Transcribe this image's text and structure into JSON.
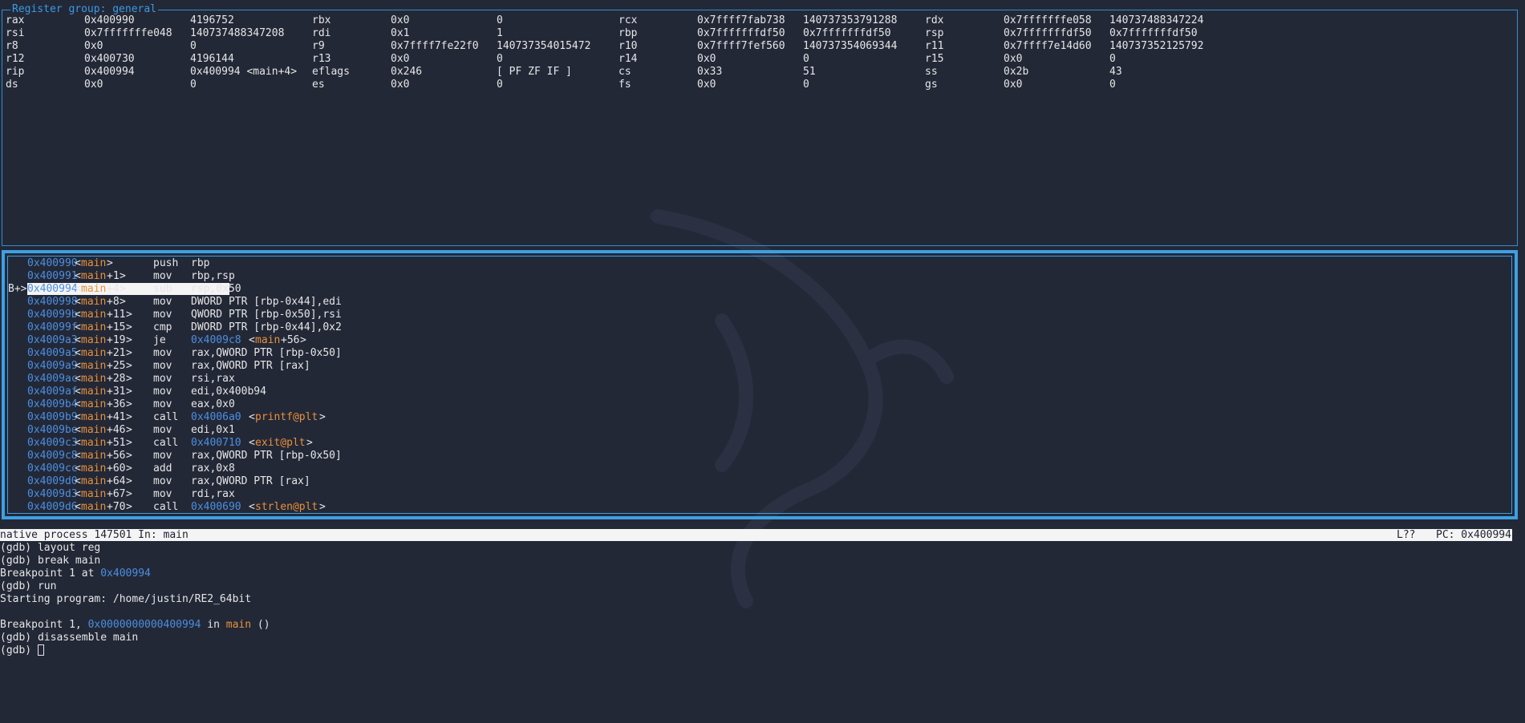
{
  "register_panel": {
    "title": "Register group: general",
    "rows": [
      [
        [
          "rax",
          "0x400990",
          "4196752"
        ],
        [
          "rbx",
          "0x0",
          "0"
        ],
        [
          "rcx",
          "0x7ffff7fab738",
          "140737353791288"
        ],
        [
          "rdx",
          "0x7fffffffe058",
          "140737488347224"
        ]
      ],
      [
        [
          "rsi",
          "0x7fffffffe048",
          "140737488347208"
        ],
        [
          "rdi",
          "0x1",
          "1"
        ],
        [
          "rbp",
          "0x7fffffffdf50",
          "0x7fffffffdf50"
        ],
        [
          "rsp",
          "0x7fffffffdf50",
          "0x7fffffffdf50"
        ]
      ],
      [
        [
          "r8",
          "0x0",
          "0"
        ],
        [
          "r9",
          "0x7ffff7fe22f0",
          "140737354015472"
        ],
        [
          "r10",
          "0x7ffff7fef560",
          "140737354069344"
        ],
        [
          "r11",
          "0x7ffff7e14d60",
          "140737352125792"
        ]
      ],
      [
        [
          "r12",
          "0x400730",
          "4196144"
        ],
        [
          "r13",
          "0x0",
          "0"
        ],
        [
          "r14",
          "0x0",
          "0"
        ],
        [
          "r15",
          "0x0",
          "0"
        ]
      ],
      [
        [
          "rip",
          "0x400994",
          "0x400994 <main+4>"
        ],
        [
          "eflags",
          "0x246",
          "[ PF ZF IF ]"
        ],
        [
          "cs",
          "0x33",
          "51"
        ],
        [
          "ss",
          "0x2b",
          "43"
        ]
      ],
      [
        [
          "ds",
          "0x0",
          "0"
        ],
        [
          "es",
          "0x0",
          "0"
        ],
        [
          "fs",
          "0x0",
          "0"
        ],
        [
          "gs",
          "0x0",
          "0"
        ]
      ]
    ]
  },
  "asm_panel": {
    "current_index": 2,
    "breakpoint_marker": "B+>",
    "rows": [
      {
        "addr": "0x400990",
        "sym": "main",
        "off": "",
        "op": "push",
        "args": "rbp",
        "t_addr": "",
        "t_sym": ""
      },
      {
        "addr": "0x400991",
        "sym": "main",
        "off": "+1",
        "op": "mov",
        "args": "rbp,rsp",
        "t_addr": "",
        "t_sym": ""
      },
      {
        "addr": "0x400994",
        "sym": "main",
        "off": "+4",
        "op": "sub",
        "args": "rsp,0x50",
        "t_addr": "",
        "t_sym": ""
      },
      {
        "addr": "0x400998",
        "sym": "main",
        "off": "+8",
        "op": "mov",
        "args": "DWORD PTR [rbp-0x44],edi",
        "t_addr": "",
        "t_sym": ""
      },
      {
        "addr": "0x40099b",
        "sym": "main",
        "off": "+11",
        "op": "mov",
        "args": "QWORD PTR [rbp-0x50],rsi",
        "t_addr": "",
        "t_sym": ""
      },
      {
        "addr": "0x40099f",
        "sym": "main",
        "off": "+15",
        "op": "cmp",
        "args": "DWORD PTR [rbp-0x44],0x2",
        "t_addr": "",
        "t_sym": ""
      },
      {
        "addr": "0x4009a3",
        "sym": "main",
        "off": "+19",
        "op": "je",
        "args": "",
        "t_addr": "0x4009c8",
        "t_sym": "main",
        "t_off": "+56"
      },
      {
        "addr": "0x4009a5",
        "sym": "main",
        "off": "+21",
        "op": "mov",
        "args": "rax,QWORD PTR [rbp-0x50]",
        "t_addr": "",
        "t_sym": ""
      },
      {
        "addr": "0x4009a9",
        "sym": "main",
        "off": "+25",
        "op": "mov",
        "args": "rax,QWORD PTR [rax]",
        "t_addr": "",
        "t_sym": ""
      },
      {
        "addr": "0x4009ac",
        "sym": "main",
        "off": "+28",
        "op": "mov",
        "args": "rsi,rax",
        "t_addr": "",
        "t_sym": ""
      },
      {
        "addr": "0x4009af",
        "sym": "main",
        "off": "+31",
        "op": "mov",
        "args": "edi,0x400b94",
        "t_addr": "",
        "t_sym": ""
      },
      {
        "addr": "0x4009b4",
        "sym": "main",
        "off": "+36",
        "op": "mov",
        "args": "eax,0x0",
        "t_addr": "",
        "t_sym": ""
      },
      {
        "addr": "0x4009b9",
        "sym": "main",
        "off": "+41",
        "op": "call",
        "args": "",
        "t_addr": "0x4006a0",
        "t_sym": "printf@plt",
        "t_off": ""
      },
      {
        "addr": "0x4009be",
        "sym": "main",
        "off": "+46",
        "op": "mov",
        "args": "edi,0x1",
        "t_addr": "",
        "t_sym": ""
      },
      {
        "addr": "0x4009c3",
        "sym": "main",
        "off": "+51",
        "op": "call",
        "args": "",
        "t_addr": "0x400710",
        "t_sym": "exit@plt",
        "t_off": ""
      },
      {
        "addr": "0x4009c8",
        "sym": "main",
        "off": "+56",
        "op": "mov",
        "args": "rax,QWORD PTR [rbp-0x50]",
        "t_addr": "",
        "t_sym": ""
      },
      {
        "addr": "0x4009cc",
        "sym": "main",
        "off": "+60",
        "op": "add",
        "args": "rax,0x8",
        "t_addr": "",
        "t_sym": ""
      },
      {
        "addr": "0x4009d0",
        "sym": "main",
        "off": "+64",
        "op": "mov",
        "args": "rax,QWORD PTR [rax]",
        "t_addr": "",
        "t_sym": ""
      },
      {
        "addr": "0x4009d3",
        "sym": "main",
        "off": "+67",
        "op": "mov",
        "args": "rdi,rax",
        "t_addr": "",
        "t_sym": ""
      },
      {
        "addr": "0x4009d6",
        "sym": "main",
        "off": "+70",
        "op": "call",
        "args": "",
        "t_addr": "0x400690",
        "t_sym": "strlen@plt",
        "t_off": ""
      }
    ]
  },
  "status_bar": {
    "left": "native process 147501 In: main",
    "line": "L??",
    "pc": "PC: 0x400994"
  },
  "console": {
    "lines": [
      "(gdb) layout reg",
      "(gdb) break main"
    ],
    "bp_line": {
      "prefix": "Breakpoint 1 at ",
      "addr": "0x400994"
    },
    "lines2": [
      "(gdb) run",
      "Starting program: /home/justin/RE2_64bit",
      ""
    ],
    "hit_line": {
      "prefix": "Breakpoint 1, ",
      "addr": "0x0000000000400994",
      "mid": " in ",
      "func": "main",
      "suffix": " ()"
    },
    "lines3": [
      "(gdb) disassemble main"
    ],
    "prompt": "(gdb) "
  },
  "colors": {
    "background": "#232837",
    "border": "#3ea0e3",
    "address": "#4b8fe0",
    "symbol": "#e8913a",
    "status_bg": "#f4f4f4"
  }
}
